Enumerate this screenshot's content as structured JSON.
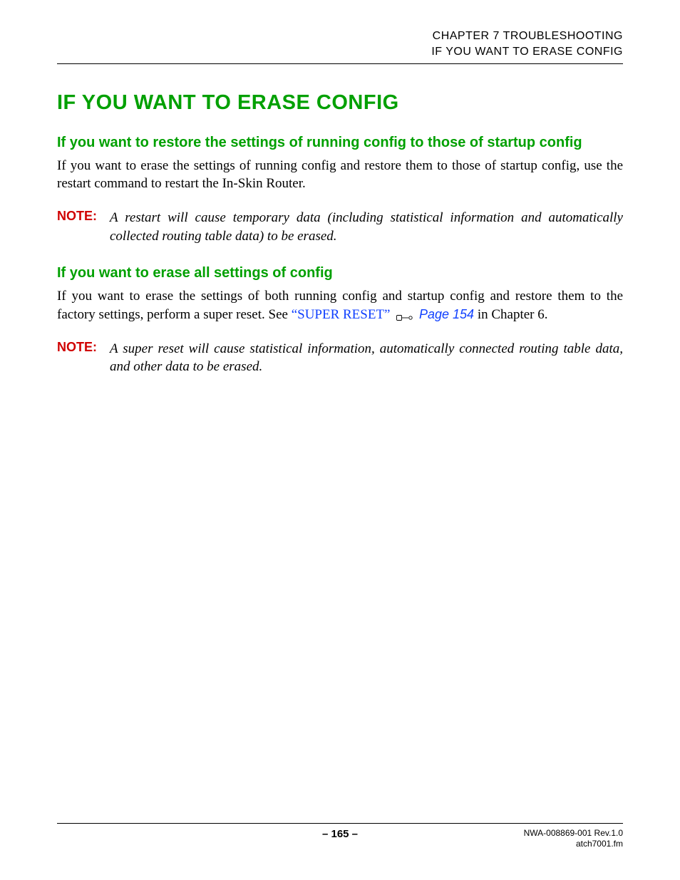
{
  "header": {
    "chapter_line": "CHAPTER 7   TROUBLESHOOTING",
    "section_line": "IF YOU WANT TO ERASE CONFIG"
  },
  "title": "IF YOU WANT TO ERASE CONFIG",
  "sections": [
    {
      "heading": "If you want to restore the settings of running config to those of startup config",
      "body": "If you want to erase the settings of running config and restore them to those of startup config, use the restart command to restart the In-Skin Router.",
      "note_label": "NOTE:",
      "note_text": "A restart will cause temporary data (including statistical information and automatically collected routing table data) to be erased."
    },
    {
      "heading": "If you want to erase all settings of config",
      "body_pre": "If you want to erase the settings of both running config and startup config and restore them to the factory settings, perform a super reset. See ",
      "link1": "“SUPER RESET”",
      "link2": "Page 154",
      "body_post": " in Chapter 6.",
      "note_label": "NOTE:",
      "note_text": "A super reset will cause statistical information, automatically connected routing table data, and other data to be erased."
    }
  ],
  "footer": {
    "page_label": "– 165 –",
    "doc_id": "NWA-008869-001 Rev.1.0",
    "file": "atch7001.fm"
  }
}
